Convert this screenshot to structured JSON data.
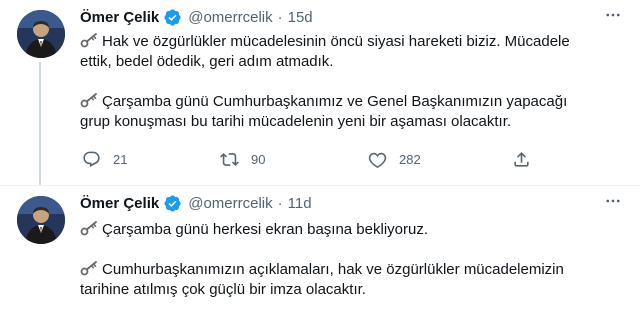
{
  "tweets": [
    {
      "author": "Ömer Çelik",
      "handle": "@omerrcelik",
      "separator": "·",
      "time": "15d",
      "paragraphs": [
        [
          "Hak ve özgürlükler mücadelesinin öncü siyasi hareketi biziz. Mücadele",
          "ettik, bedel ödedik, geri adım atmadık."
        ],
        [
          "Çarşamba günü Cumhurbaşkanımız ve Genel Başkanımızın yapacağı",
          "grup konuşması bu tarihi mücadelenin yeni bir aşaması olacaktır."
        ]
      ],
      "stats": {
        "replies": "21",
        "retweets": "90",
        "likes": "282"
      }
    },
    {
      "author": "Ömer Çelik",
      "handle": "@omerrcelik",
      "separator": "·",
      "time": "11d",
      "paragraphs": [
        [
          "Çarşamba günü herkesi ekran başına bekliyoruz."
        ],
        [
          "Cumhurbaşkanımızın açıklamaları, hak ve özgürlükler mücadelemizin",
          "tarihine atılmış çok güçlü bir imza olacaktır."
        ]
      ]
    }
  ],
  "icons": {
    "verified": "verified-badge-icon",
    "key": "old-key-emoji-icon",
    "more": "more-dots-icon",
    "reply": "reply-icon",
    "retweet": "retweet-icon",
    "like": "heart-icon",
    "share": "share-icon"
  },
  "colors": {
    "verified": "#1d9bf0",
    "muted": "#536471",
    "text": "#0f1419",
    "thread_line": "#cfd9de"
  }
}
